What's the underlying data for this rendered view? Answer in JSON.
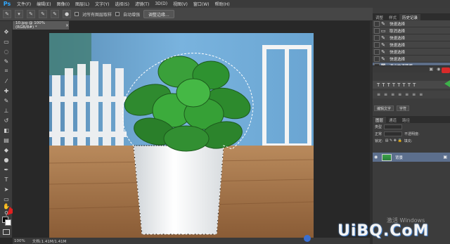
{
  "app": {
    "logo": "Ps"
  },
  "menu": [
    "文件(F)",
    "编辑(E)",
    "图像(I)",
    "图层(L)",
    "文字(Y)",
    "选择(S)",
    "滤镜(T)",
    "3D(D)",
    "视图(V)",
    "窗口(W)",
    "帮助(H)"
  ],
  "options": {
    "sample_all_layers": "对所有图层取样",
    "auto_enhance": "自动增强",
    "refine_edge": "调整边缘..."
  },
  "document": {
    "tab_title": "10.jpg @ 100%(RGB/8#) *",
    "close": "×"
  },
  "status": {
    "zoom": "100%",
    "doc_size": "文档:1.41M/1.41M"
  },
  "panels": {
    "top_tabs": [
      "调整",
      "样式",
      "历史记录"
    ],
    "active_top_tab": 2,
    "history": [
      {
        "label": "快速选择",
        "active": false
      },
      {
        "label": "取消选择",
        "active": false
      },
      {
        "label": "快速选择",
        "active": false
      },
      {
        "label": "快速选择",
        "active": false
      },
      {
        "label": "快速选择",
        "active": false
      },
      {
        "label": "快速选择",
        "active": false
      },
      {
        "label": "退出快速蒙版",
        "active": true
      }
    ],
    "para_btns": [
      "编辑文字",
      "字符"
    ],
    "layers_tabs": [
      "图层",
      "通道",
      "路径"
    ],
    "layers": {
      "kind": "类型",
      "blend": "正常",
      "opacity": "不透明度:",
      "lock": "锁定:",
      "fill": "填充:",
      "layer_name": "背景"
    }
  },
  "overlay": {
    "windows_activate": "激活 Windows",
    "watermark": "UiBQ.CoM"
  },
  "colors": {
    "accent": "#31a8ff",
    "history_active": "#5d6e88",
    "layer_active": "#5c6f8d",
    "annotation_red": "#e02020"
  }
}
